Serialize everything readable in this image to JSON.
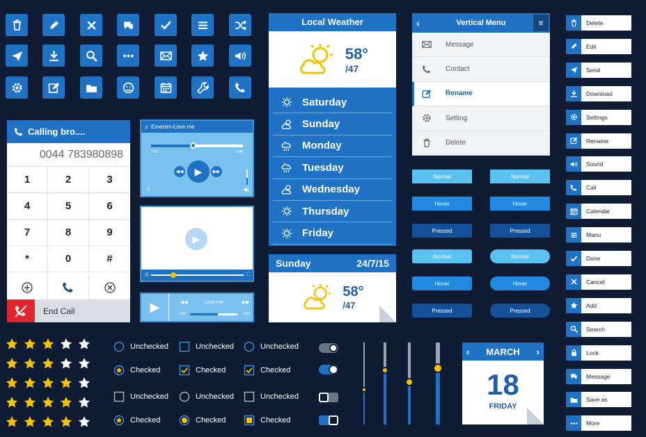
{
  "dialer": {
    "title": "Calling bro....",
    "number": "0044 783980898",
    "keys": [
      "1",
      "2",
      "3",
      "4",
      "5",
      "6",
      "7",
      "8",
      "9",
      "*",
      "0",
      "#"
    ],
    "end_label": "End Call"
  },
  "player1": {
    "title": "Emenim-Love me",
    "time_start": "2:50",
    "time_end": "5:40"
  },
  "player3": {
    "title": "Love me",
    "time_start": "2:50",
    "time_end": "5:40"
  },
  "weather": {
    "title": "Local Weather",
    "temp": "58°",
    "low": "/47",
    "days": [
      "Saturday",
      "Sunday",
      "Monday",
      "Tuesday",
      "Wednesday",
      "Thursday",
      "Friday"
    ]
  },
  "weather2": {
    "day": "Sunday",
    "date": "24/7/15",
    "temp": "58°",
    "low": "/47"
  },
  "vmenu": {
    "title": "Vertical Menu",
    "items": [
      "Message",
      "Contact",
      "Rename",
      "Setting",
      "Delete"
    ]
  },
  "states": [
    "Normal",
    "Hover",
    "Pressed"
  ],
  "right_list": [
    "Delete",
    "Edit",
    "Send",
    "Download",
    "Settings",
    "Rename",
    "Sound",
    "Call",
    "Calendar",
    "Manu",
    "Done",
    "Cancel",
    "Add",
    "Search",
    "Lock",
    "Message",
    "Save as",
    "More"
  ],
  "checks": {
    "unchecked": "Unchecked",
    "checked": "Checked"
  },
  "calendar": {
    "month": "MARCH",
    "day": "18",
    "weekday": "FRIDAY"
  },
  "sliders": [
    0.42,
    0.66,
    0.52,
    0.69
  ],
  "colors": {
    "bg": "#0f1c33",
    "primary": "#1f72c4",
    "light": "#5bc1f1",
    "pressed": "#1a5fb8",
    "star": "#f3c300"
  },
  "icon_grid": [
    "trash-icon",
    "pencil-icon",
    "close-icon",
    "chat-icon",
    "check-icon",
    "menu-icon",
    "shuffle-icon",
    "send-icon",
    "download-icon",
    "search-icon",
    "more-icon",
    "mail-icon",
    "star-icon",
    "sound-icon",
    "gear-icon",
    "edit-icon",
    "folder-icon",
    "smile-icon",
    "calendar-icon",
    "wrench-icon",
    "phone-icon"
  ]
}
